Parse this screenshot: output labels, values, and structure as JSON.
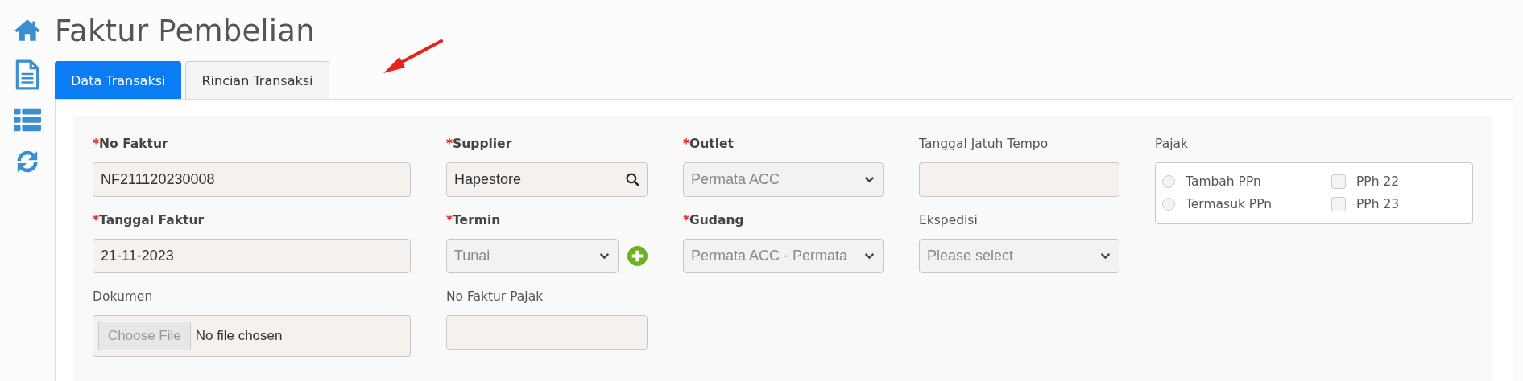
{
  "page_title": "Faktur Pembelian",
  "tabs": [
    {
      "label": "Data Transaksi",
      "selected": true
    },
    {
      "label": "Rincian Transaksi",
      "selected": false
    }
  ],
  "form": {
    "columns": [
      [
        {
          "label": "No Faktur",
          "mark": "*",
          "kind": "text",
          "value": "NF211120230008"
        },
        {
          "label": "Tanggal Faktur",
          "mark": "*",
          "kind": "text",
          "value": "21-11-2023"
        },
        {
          "label": "Dokumen",
          "kind": "file",
          "button": "Choose File",
          "value": "No file chosen"
        }
      ],
      [
        {
          "label": "Supplier",
          "mark": "*",
          "kind": "search",
          "value": "Hapestore"
        },
        {
          "label": "Termin",
          "mark": "*",
          "kind": "select",
          "value": "Tunai",
          "disabled": true,
          "add_button": true
        },
        {
          "label": "No Faktur Pajak",
          "kind": "text"
        }
      ],
      [
        {
          "label": "Outlet",
          "mark": "*",
          "kind": "select",
          "value": "Permata ACC",
          "disabled": true
        },
        {
          "label": "Gudang",
          "mark": "*",
          "kind": "select",
          "value": "Permata ACC - Permata",
          "disabled": true
        }
      ],
      [
        {
          "label": "Tanggal Jatuh Tempo",
          "kind": "text"
        },
        {
          "label": "Ekspedisi",
          "kind": "select",
          "placeholder": "Please select"
        }
      ],
      [
        {
          "label": "Pajak",
          "kind": "options",
          "options": [
            {
              "kind": "radio",
              "label": "Tambah PPn",
              "checked": false
            },
            {
              "kind": "radio",
              "label": "Termasuk PPn",
              "checked": false
            },
            {
              "kind": "checkbox",
              "label": "PPh 22",
              "checked": false
            },
            {
              "kind": "checkbox",
              "label": "PPh 23",
              "checked": false
            }
          ]
        }
      ]
    ]
  }
}
